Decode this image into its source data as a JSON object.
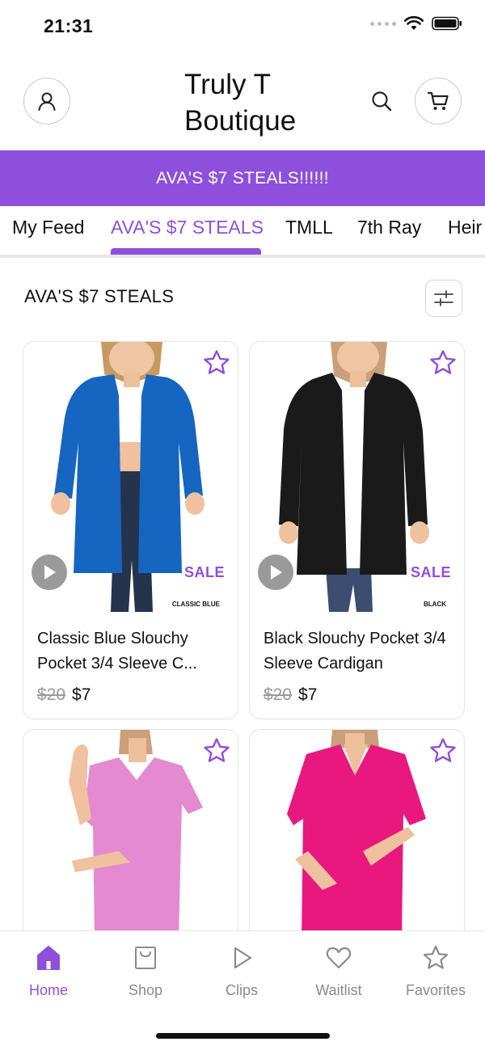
{
  "status_bar": {
    "time": "21:31"
  },
  "header": {
    "store_title": "Truly T Boutique"
  },
  "banner": {
    "text": "AVA'S $7 STEALS!!!!!!"
  },
  "tabs": [
    {
      "label": "My Feed"
    },
    {
      "label": "AVA'S $7 STEALS"
    },
    {
      "label": "TMLL"
    },
    {
      "label": "7th Ray"
    },
    {
      "label": "Heir"
    }
  ],
  "section": {
    "title": "AVA'S $7 STEALS"
  },
  "products": [
    {
      "name": "Classic Blue Slouchy Pocket 3/4 Sleeve C...",
      "old_price": "$20",
      "price": "$7",
      "badge": "SALE",
      "color_tag": "CLASSIC BLUE",
      "garment_color": "#1665c0"
    },
    {
      "name": "Black Slouchy Pocket 3/4 Sleeve Cardigan",
      "old_price": "$20",
      "price": "$7",
      "badge": "SALE",
      "color_tag": "BLACK",
      "garment_color": "#1a1a1a"
    },
    {
      "garment_color": "#e48ad0"
    },
    {
      "garment_color": "#e8187e"
    }
  ],
  "bottom_nav": [
    {
      "label": "Home",
      "icon": "home-icon",
      "active": true
    },
    {
      "label": "Shop",
      "icon": "shop-icon"
    },
    {
      "label": "Clips",
      "icon": "play-icon"
    },
    {
      "label": "Waitlist",
      "icon": "heart-icon"
    },
    {
      "label": "Favorites",
      "icon": "star-icon"
    }
  ],
  "colors": {
    "accent": "#8e4fdc"
  }
}
